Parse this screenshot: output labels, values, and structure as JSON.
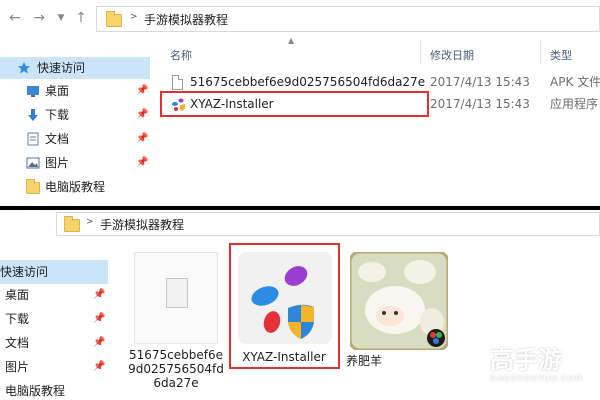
{
  "top": {
    "breadcrumb": [
      "手游模拟器教程"
    ],
    "sidebar": [
      {
        "label": "快速访问",
        "icon": "star-icon",
        "selected": true,
        "pinned": false
      },
      {
        "label": "桌面",
        "icon": "desktop-icon",
        "pinned": true
      },
      {
        "label": "下载",
        "icon": "download-icon",
        "pinned": true
      },
      {
        "label": "文档",
        "icon": "document-icon",
        "pinned": true
      },
      {
        "label": "图片",
        "icon": "picture-icon",
        "pinned": true
      },
      {
        "label": "电脑版教程",
        "icon": "folder-icon",
        "pinned": false
      }
    ],
    "columns": {
      "name": "名称",
      "date": "修改日期",
      "type": "类型"
    },
    "files": [
      {
        "name": "51675cebbef6e9d025756504fd6da27e",
        "date": "2017/4/13 15:43",
        "type": "APK 文件",
        "icon": "file-icon"
      },
      {
        "name": "XYAZ-Installer",
        "date": "2017/4/13 15:43",
        "type": "应用程序",
        "icon": "xyaz-app-icon",
        "highlighted": true
      }
    ]
  },
  "bottom": {
    "breadcrumb": [
      "手游模拟器教程"
    ],
    "sidebar": [
      {
        "label": "快速访问",
        "selected": true,
        "pinned": false
      },
      {
        "label": "桌面",
        "pinned": true
      },
      {
        "label": "下载",
        "pinned": true
      },
      {
        "label": "文档",
        "pinned": true
      },
      {
        "label": "图片",
        "pinned": true
      },
      {
        "label": "电脑版教程",
        "pinned": false
      }
    ],
    "tiles": [
      {
        "name_lines": [
          "51675cebbef6e",
          "9d025756504fd",
          "6da27e"
        ],
        "icon": "blank-file-icon"
      },
      {
        "name_lines": [
          "XYAZ-Installer"
        ],
        "icon": "xyaz-app-icon",
        "highlighted": true
      },
      {
        "name_lines": [
          "养肥羊"
        ],
        "icon": "sheep-game-icon"
      }
    ]
  },
  "watermark": {
    "brand": "高手游",
    "domain": "GAOSHOUYOU.COM"
  },
  "colors": {
    "highlight": "#e03030",
    "selected_bg": "#cce4f7",
    "folder": "#f6d36b"
  }
}
